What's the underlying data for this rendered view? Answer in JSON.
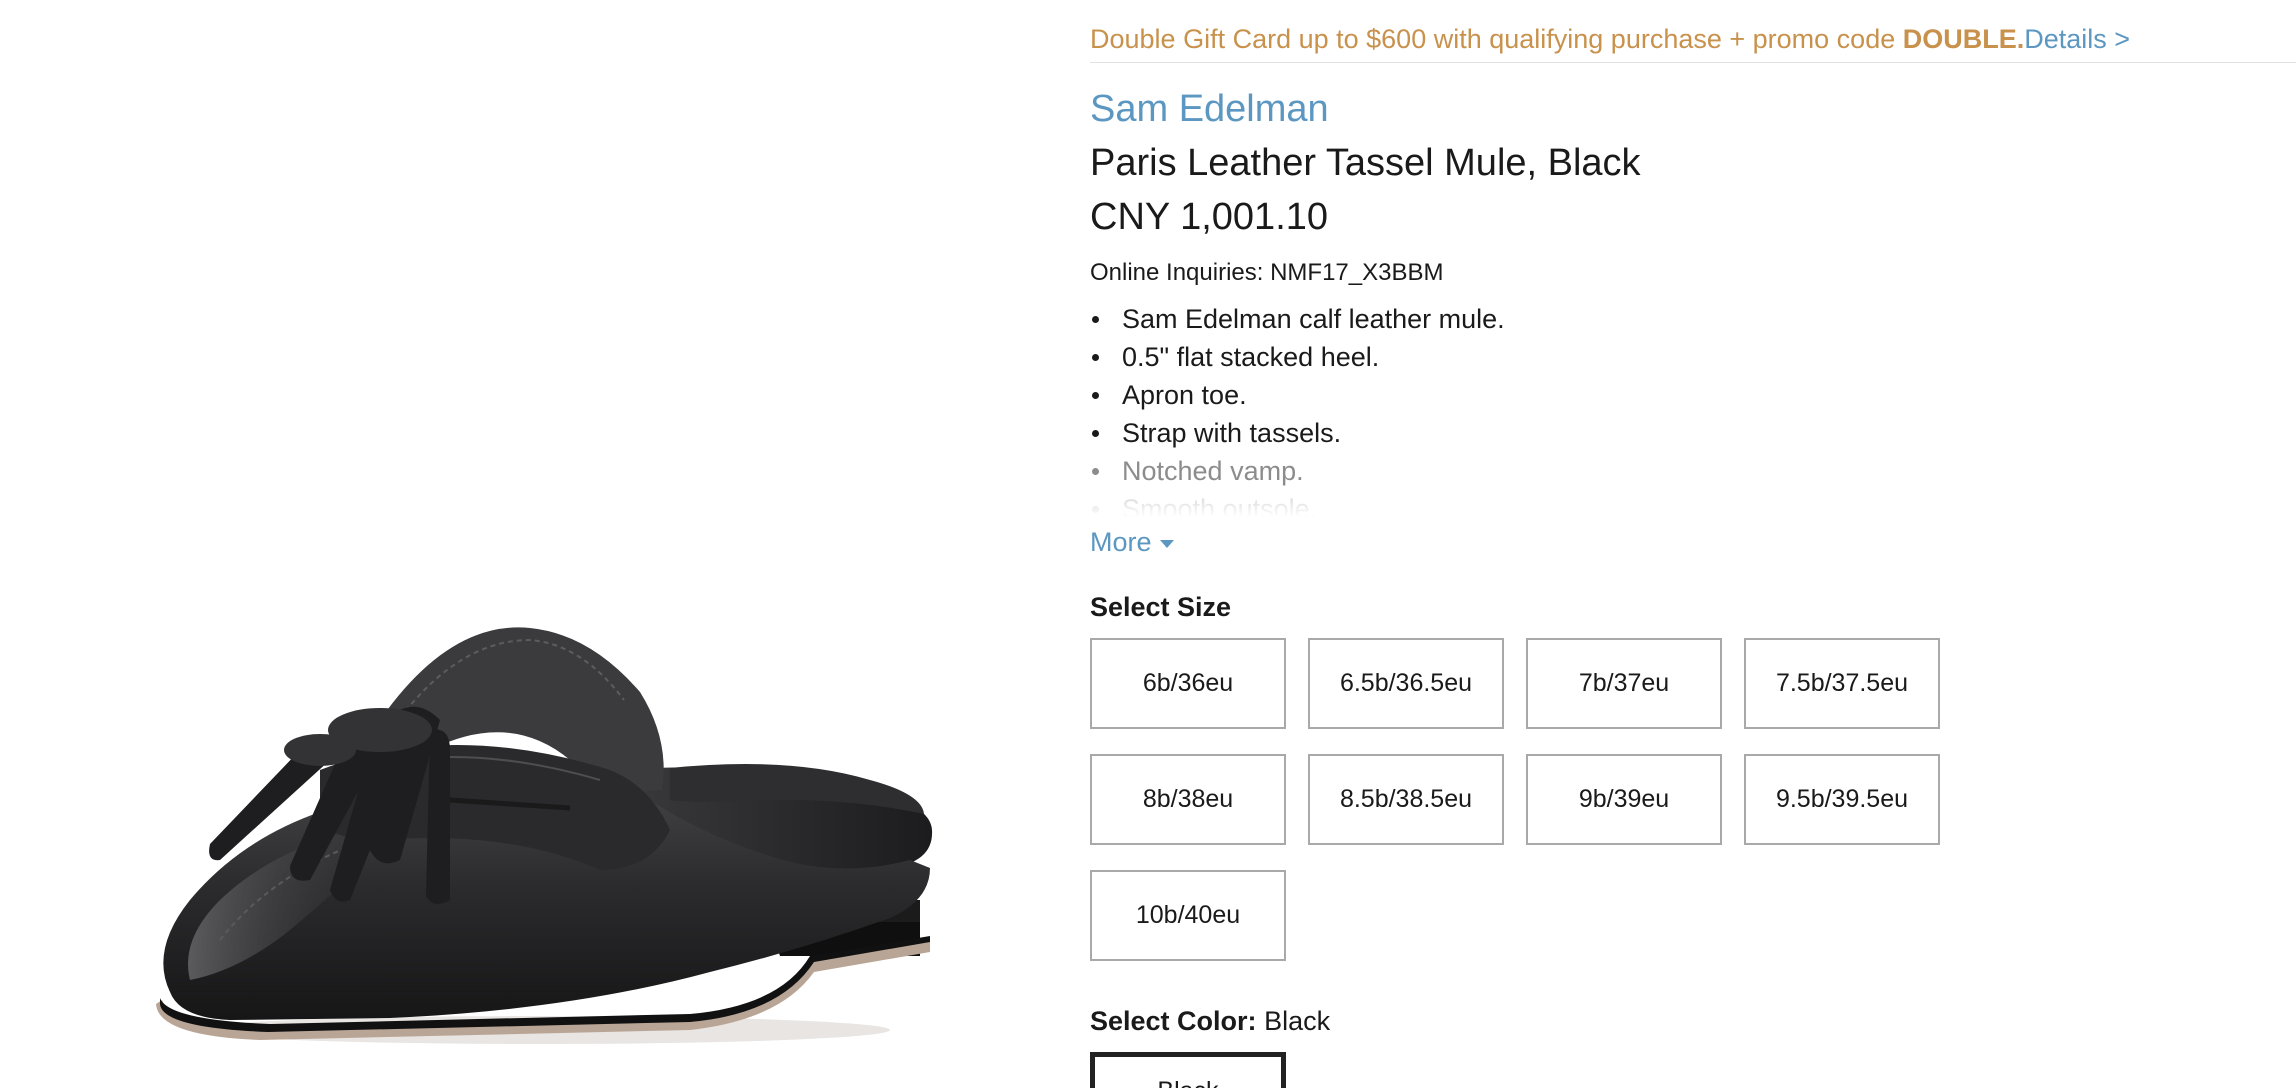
{
  "promo": {
    "text": "Double Gift Card up to $600 with qualifying purchase + promo code ",
    "code": "DOUBLE.",
    "details_link": "Details >"
  },
  "product": {
    "brand": "Sam Edelman",
    "name": "Paris Leather Tassel Mule, Black",
    "price": "CNY 1,001.10",
    "inquiries": "Online Inquiries: NMF17_X3BBM",
    "features": [
      "Sam Edelman calf leather mule.",
      "0.5\" flat stacked heel.",
      "Apron toe.",
      "Strap with tassels.",
      "Notched vamp.",
      "Smooth outsole."
    ],
    "more_label": "More"
  },
  "size": {
    "label": "Select Size",
    "options": [
      "6b/36eu",
      "6.5b/36.5eu",
      "7b/37eu",
      "7.5b/37.5eu",
      "8b/38eu",
      "8.5b/38.5eu",
      "9b/39eu",
      "9.5b/39.5eu",
      "10b/40eu"
    ]
  },
  "color": {
    "label": "Select Color:",
    "value": "Black",
    "swatch_label": "Black"
  },
  "colors": {
    "link": "#5b97c0",
    "promo": "#c8914c",
    "box_border": "#a9a9a9"
  },
  "icons": {
    "more_caret": "caret-down-icon"
  }
}
